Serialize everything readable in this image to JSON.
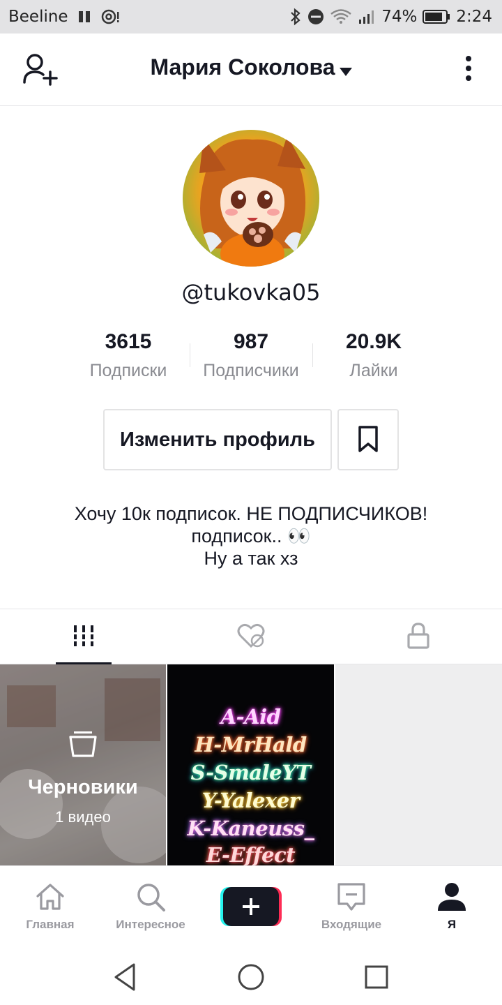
{
  "status_bar": {
    "carrier": "Beeline",
    "battery_percent": "74%",
    "time": "2:24"
  },
  "header": {
    "title": "Мария Соколова"
  },
  "profile": {
    "username": "@tukovka05",
    "stats": [
      {
        "value": "3615",
        "label": "Подписки"
      },
      {
        "value": "987",
        "label": "Подписчики"
      },
      {
        "value": "20.9K",
        "label": "Лайки"
      }
    ],
    "edit_button_label": "Изменить профиль",
    "bio_lines": [
      "Хочу 10к подписок. НЕ ПОДПИСЧИКОВ!",
      "подписок.. 👀",
      "Ну а так хз"
    ]
  },
  "tabs": [
    "videos-grid-icon",
    "liked-private-icon",
    "lock-icon"
  ],
  "grid": {
    "drafts_title": "Черновики",
    "drafts_count": "1 видео",
    "video2_lines": [
      "A-Aid",
      "H-MrHald",
      "S-SmaleYT",
      "Y-Yalexer",
      "K-Kaneuss_",
      "E-Effect"
    ]
  },
  "bottom_nav": [
    {
      "label": "Главная",
      "icon": "home-icon"
    },
    {
      "label": "Интересное",
      "icon": "search-icon"
    },
    {
      "label": "",
      "icon": "create-plus-icon"
    },
    {
      "label": "Входящие",
      "icon": "inbox-icon"
    },
    {
      "label": "Я",
      "icon": "profile-icon"
    }
  ],
  "colors": {
    "text_primary": "#161823",
    "text_secondary": "#8a8b91",
    "plus_cyan": "#25f4ee",
    "plus_pink": "#fe2c55"
  }
}
